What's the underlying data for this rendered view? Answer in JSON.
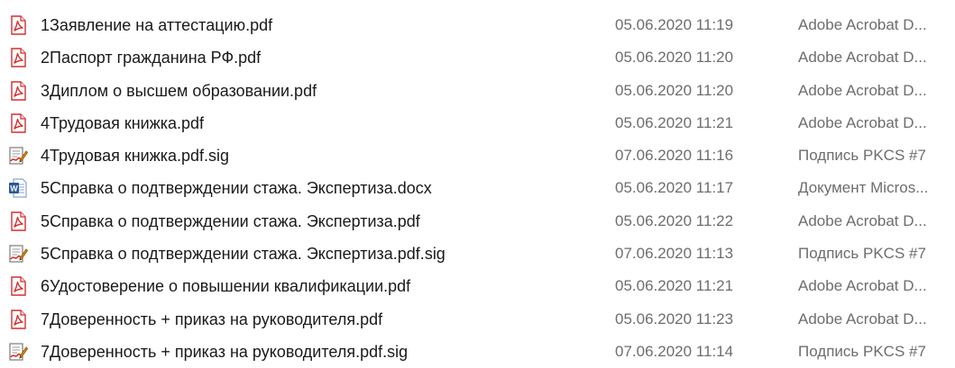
{
  "files": [
    {
      "name": "1Заявление на аттестацию.pdf",
      "date": "05.06.2020 11:19",
      "type": "Adobe Acrobat D...",
      "icon": "pdf-icon"
    },
    {
      "name": "2Паспорт гражданина РФ.pdf",
      "date": "05.06.2020 11:20",
      "type": "Adobe Acrobat D...",
      "icon": "pdf-icon"
    },
    {
      "name": "3Диплом о высшем образовании.pdf",
      "date": "05.06.2020 11:20",
      "type": "Adobe Acrobat D...",
      "icon": "pdf-icon"
    },
    {
      "name": "4Трудовая книжка.pdf",
      "date": "05.06.2020 11:21",
      "type": "Adobe Acrobat D...",
      "icon": "pdf-icon"
    },
    {
      "name": "4Трудовая книжка.pdf.sig",
      "date": "07.06.2020 11:16",
      "type": "Подпись PKCS #7",
      "icon": "signature-icon"
    },
    {
      "name": "5Справка о подтверждении стажа. Экспертиза.docx",
      "date": "05.06.2020 11:17",
      "type": "Документ Micros...",
      "icon": "word-icon"
    },
    {
      "name": "5Справка о подтверждении стажа. Экспертиза.pdf",
      "date": "05.06.2020 11:22",
      "type": "Adobe Acrobat D...",
      "icon": "pdf-icon"
    },
    {
      "name": "5Справка о подтверждении стажа. Экспертиза.pdf.sig",
      "date": "07.06.2020 11:13",
      "type": "Подпись PKCS #7",
      "icon": "signature-icon"
    },
    {
      "name": "6Удостоверение о повышении квалификации.pdf",
      "date": "05.06.2020 11:21",
      "type": "Adobe Acrobat D...",
      "icon": "pdf-icon"
    },
    {
      "name": "7Доверенность + приказ на руководителя.pdf",
      "date": "05.06.2020 11:23",
      "type": "Adobe Acrobat D...",
      "icon": "pdf-icon"
    },
    {
      "name": "7Доверенность + приказ на руководителя.pdf.sig",
      "date": "07.06.2020 11:14",
      "type": "Подпись PKCS #7",
      "icon": "signature-icon"
    }
  ],
  "colors": {
    "pdf_red": "#d32f2f",
    "word_blue": "#2b579a",
    "name_text": "#1a1a1a",
    "meta_text": "#6d6d6d"
  }
}
